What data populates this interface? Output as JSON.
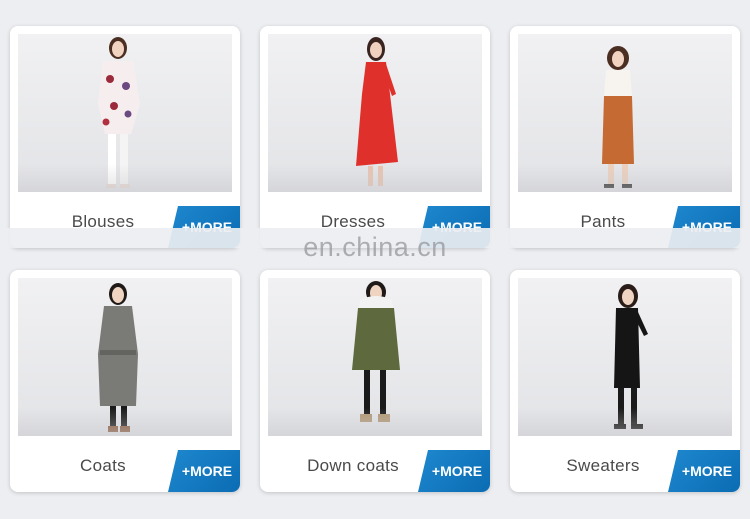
{
  "categories": [
    {
      "label": "Blouses",
      "more": "+MORE"
    },
    {
      "label": "Dresses",
      "more": "+MORE"
    },
    {
      "label": "Pants",
      "more": "+MORE"
    },
    {
      "label": "Coats",
      "more": "+MORE"
    },
    {
      "label": "Down coats",
      "more": "+MORE"
    },
    {
      "label": "Sweaters",
      "more": "+MORE"
    }
  ],
  "watermark": "en.china.cn",
  "colors": {
    "more_button": "#1479c4",
    "background": "#eceef1",
    "label_text": "#4a4a4a",
    "dress_red": "#e0302b",
    "pants_rust": "#c46a32",
    "coat_grey": "#7a7a76",
    "parka_olive": "#5e6a3e"
  }
}
